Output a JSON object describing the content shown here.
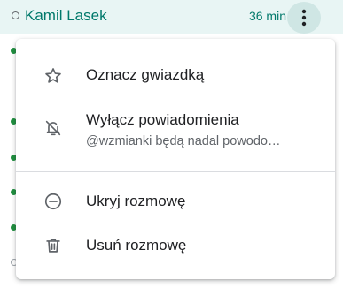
{
  "chat": {
    "name": "Kamil Lasek",
    "time": "36 min"
  },
  "menu": {
    "items": [
      {
        "label": "Oznacz gwiazdką",
        "icon": "star-outline-icon"
      },
      {
        "label": "Wyłącz powiadomienia",
        "sublabel": "@wzmianki będą nadal powodo…",
        "icon": "notifications-off-icon"
      },
      {
        "label": "Ukryj rozmowę",
        "icon": "hide-circle-minus-icon"
      },
      {
        "label": "Usuń rozmowę",
        "icon": "trash-icon"
      }
    ]
  },
  "colors": {
    "accent": "#00796b",
    "row_highlight": "#e8f5f4",
    "online": "#1e8e3e",
    "icon": "#5f6368",
    "text": "#202124"
  }
}
